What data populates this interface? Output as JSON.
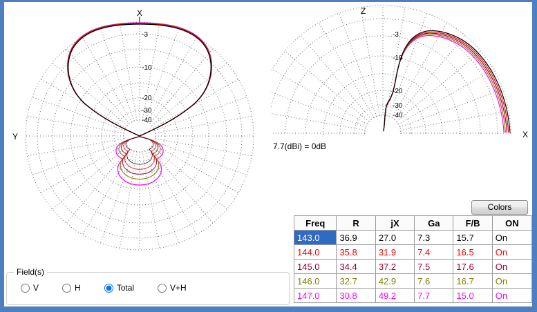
{
  "window": {
    "border_color": "#4e80bf",
    "background": "#ffffff"
  },
  "left_plot": {
    "axis_top": "X",
    "axis_left": "Y",
    "scale_labels": [
      "-3",
      "-10",
      "-20",
      "-30",
      "-40"
    ]
  },
  "right_plot": {
    "axis_top": "Z",
    "axis_right": "X",
    "scale_labels": [
      "-3",
      "-10",
      "-20",
      "-30",
      "-40"
    ],
    "reference_text": "7.7(dBi) = 0dB"
  },
  "colors_button": {
    "label": "Colors"
  },
  "table": {
    "headers": [
      "Freq",
      "R",
      "jX",
      "Ga",
      "F/B",
      "ON"
    ],
    "selection_bg": "#316ac5",
    "selection_fg": "#ffffff",
    "rows": [
      {
        "freq": "143.0",
        "r": "36.9",
        "jx": "27.0",
        "ga": "7.3",
        "fb": "15.7",
        "on": "On",
        "color": "#000000",
        "selected": true
      },
      {
        "freq": "144.0",
        "r": "35.8",
        "jx": "31.9",
        "ga": "7.4",
        "fb": "16.5",
        "on": "On",
        "color": "#ff0000",
        "selected": false
      },
      {
        "freq": "145.0",
        "r": "34.4",
        "jx": "37.2",
        "ga": "7.5",
        "fb": "17.6",
        "on": "On",
        "color": "#990033",
        "selected": false
      },
      {
        "freq": "146.0",
        "r": "32.7",
        "jx": "42.9",
        "ga": "7.6",
        "fb": "16.7",
        "on": "On",
        "color": "#808000",
        "selected": false
      },
      {
        "freq": "147.0",
        "r": "30.8",
        "jx": "49.2",
        "ga": "7.7",
        "fb": "15.0",
        "on": "On",
        "color": "#ff00ff",
        "selected": false
      }
    ]
  },
  "fields_group": {
    "label": "Field(s)",
    "options": [
      {
        "label": "V",
        "selected": false
      },
      {
        "label": "H",
        "selected": false
      },
      {
        "label": "Total",
        "selected": true
      },
      {
        "label": "V+H",
        "selected": false
      }
    ]
  }
}
